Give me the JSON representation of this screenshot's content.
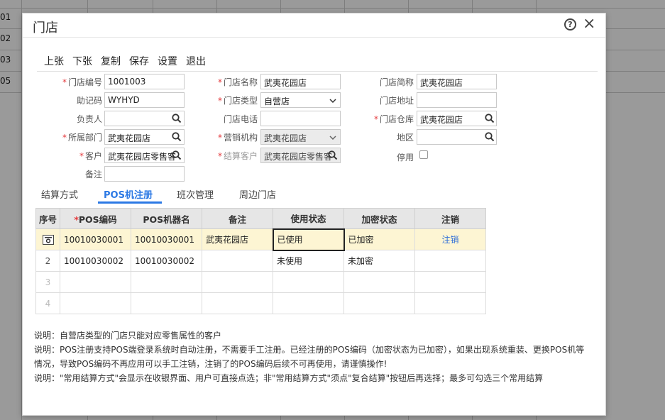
{
  "background": {
    "row_labels": [
      "01",
      "02",
      "03",
      "05"
    ]
  },
  "dialog": {
    "title": "门店",
    "help_icon": "?",
    "close_icon": "×"
  },
  "toolbar": {
    "items": [
      "上张",
      "下张",
      "复制",
      "保存",
      "设置",
      "退出"
    ]
  },
  "form": {
    "store_code": {
      "label": "门店编号",
      "value": "1001003",
      "required": true
    },
    "store_name": {
      "label": "门店名称",
      "value": "武夷花园店",
      "required": true
    },
    "store_short": {
      "label": "门店简称",
      "value": "武夷花园店"
    },
    "mnemonic": {
      "label": "助记码",
      "value": "WYHYD"
    },
    "store_type": {
      "label": "门店类型",
      "value": "自营店",
      "required": true
    },
    "store_address": {
      "label": "门店地址",
      "value": ""
    },
    "manager": {
      "label": "负责人",
      "value": ""
    },
    "store_phone": {
      "label": "门店电话",
      "value": ""
    },
    "store_warehouse": {
      "label": "门店仓库",
      "value": "武夷花园店",
      "required": true
    },
    "department": {
      "label": "所属部门",
      "value": "武夷花园店",
      "required": true
    },
    "sales_org": {
      "label": "营销机构",
      "value": "武夷花园店",
      "required": true
    },
    "region": {
      "label": "地区",
      "value": ""
    },
    "customer": {
      "label": "客户",
      "value": "武夷花园店零售客",
      "required": true
    },
    "settle_customer": {
      "label": "结算客户",
      "value": "武夷花园店零售客",
      "required": true
    },
    "disabled": {
      "label": "停用"
    },
    "remark": {
      "label": "备注",
      "value": ""
    }
  },
  "tabs": [
    {
      "label": "结算方式",
      "active": false
    },
    {
      "label": "POS机注册",
      "active": true
    },
    {
      "label": "班次管理",
      "active": false
    },
    {
      "label": "周边门店",
      "active": false
    }
  ],
  "pos_table": {
    "headers": [
      "序号",
      "POS编码",
      "POS机器名",
      "备注",
      "使用状态",
      "加密状态",
      "注销"
    ],
    "rows": [
      {
        "num": "",
        "code": "10010030001",
        "machine": "10010030001",
        "remark": "武夷花园店",
        "use_status": "已使用",
        "enc_status": "已加密",
        "action": "注销"
      },
      {
        "num": "2",
        "code": "10010030002",
        "machine": "10010030002",
        "remark": "",
        "use_status": "未使用",
        "enc_status": "未加密",
        "action": ""
      },
      {
        "num": "3",
        "code": "",
        "machine": "",
        "remark": "",
        "use_status": "",
        "enc_status": "",
        "action": ""
      },
      {
        "num": "4",
        "code": "",
        "machine": "",
        "remark": "",
        "use_status": "",
        "enc_status": "",
        "action": ""
      }
    ]
  },
  "notes": [
    "说明：自营店类型的门店只能对应零售属性的客户",
    "说明：POS注册支持POS端登录系统时自动注册，不需要手工注册。已经注册的POS编码（加密状态为已加密），如果出现系统重装、更换POS机等",
    "情况，导致POS编码不再应用可以手工注销，注销了的POS编码后续不可再使用，请谨慎操作!",
    "说明：\"常用结算方式\"会显示在收银界面、用户可直接点选；非\"常用结算方式\"须点\"复合结算\"按钮后再选择；最多可勾选三个常用结算"
  ]
}
